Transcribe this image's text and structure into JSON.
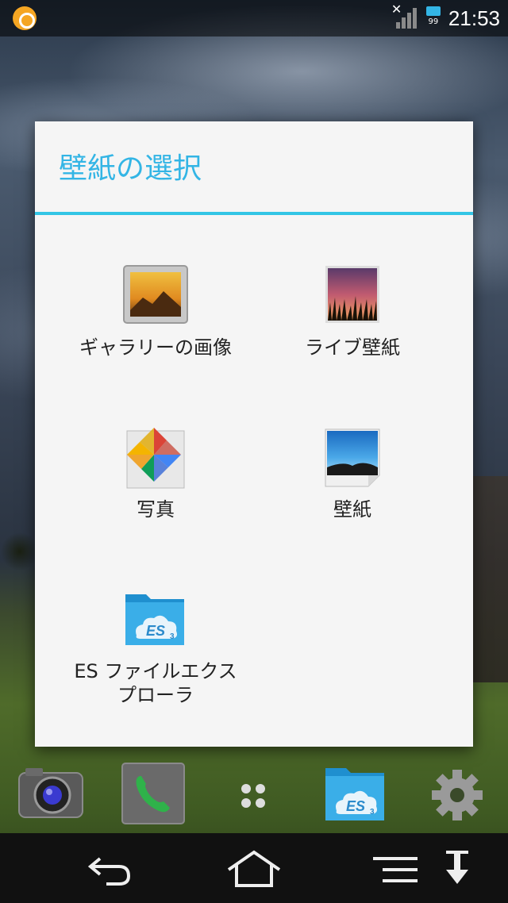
{
  "status_bar": {
    "time": "21:53",
    "battery_level": "99",
    "notification_icon": "app-notification-icon",
    "signal_icon": "signal-no-service-icon"
  },
  "dialog": {
    "title": "壁紙の選択",
    "accent_color": "#33b5e5",
    "options": [
      {
        "label": "ギャラリーの画像",
        "icon": "gallery-icon"
      },
      {
        "label": "ライブ壁紙",
        "icon": "live-wallpaper-icon"
      },
      {
        "label": "写真",
        "icon": "photos-icon"
      },
      {
        "label": "壁紙",
        "icon": "wallpaper-icon"
      },
      {
        "label": "ES ファイルエクスプローラ",
        "icon": "es-file-explorer-icon"
      }
    ]
  },
  "dock": {
    "items": [
      "camera-icon",
      "phone-icon",
      "app-drawer-icon",
      "es-file-explorer-icon",
      "settings-gear-icon"
    ]
  },
  "nav_bar": {
    "buttons": [
      "back-icon",
      "home-icon",
      "menu-icon",
      "download-icon"
    ]
  }
}
